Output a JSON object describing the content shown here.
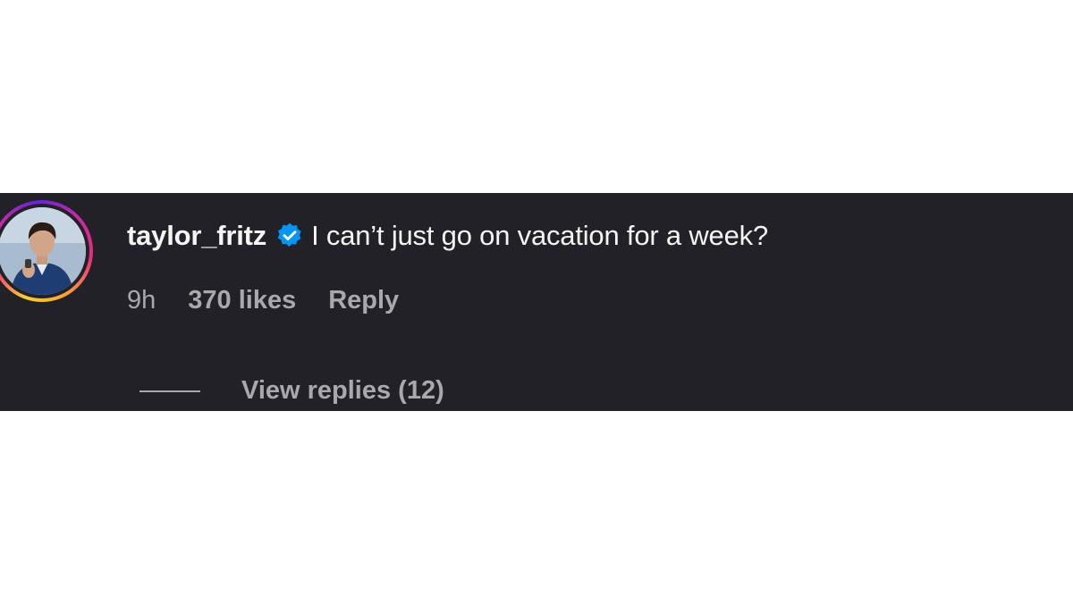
{
  "comment": {
    "username": "taylor_fritz",
    "verified": true,
    "text": "I can’t just go on vacation for a week?",
    "timestamp": "9h",
    "likes": "370 likes",
    "reply_label": "Reply",
    "view_replies_label": "View replies (12)"
  },
  "colors": {
    "panel_background": "#212127",
    "primary_text": "#f5f5f5",
    "secondary_text": "#a8a8ad",
    "verified_badge": "#0095f6"
  },
  "icons": {
    "verified": "verified-badge-icon",
    "avatar": "profile-photo"
  }
}
